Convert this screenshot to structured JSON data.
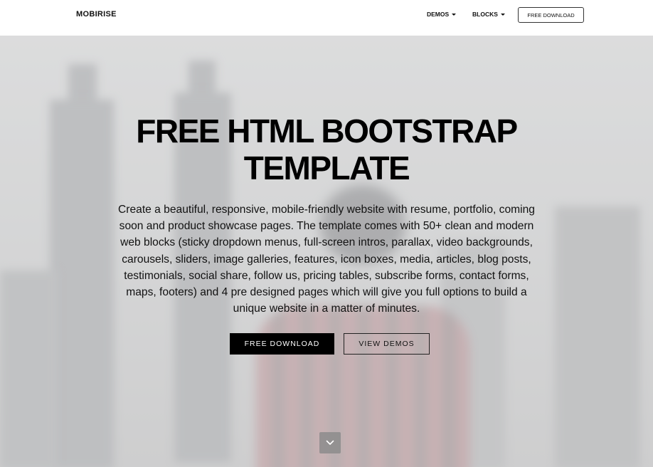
{
  "header": {
    "brand": "MOBIRISE",
    "nav": [
      {
        "label": "DEMOS"
      },
      {
        "label": "BLOCKS"
      }
    ],
    "download_label": "FREE DOWNLOAD"
  },
  "hero": {
    "title_line1": "FREE HTML BOOTSTRAP",
    "title_line2": "TEMPLATE",
    "description": "Create a beautiful, responsive, mobile-friendly website with resume, portfolio, coming soon and product showcase pages. The template comes with 50+ clean and modern web blocks (sticky dropdown menus, full-screen intros, parallax, video backgrounds, carousels, sliders, image galleries, features, icon boxes, media, articles, blog posts, testimonials, social share, follow us, pricing tables, subscribe forms, contact forms, maps, footers) and 4 pre designed pages which will give you full options to build a unique website in a matter of minutes.",
    "primary_button": "FREE DOWNLOAD",
    "secondary_button": "VIEW DEMOS",
    "scroll_icon": "chevron-down-icon"
  }
}
